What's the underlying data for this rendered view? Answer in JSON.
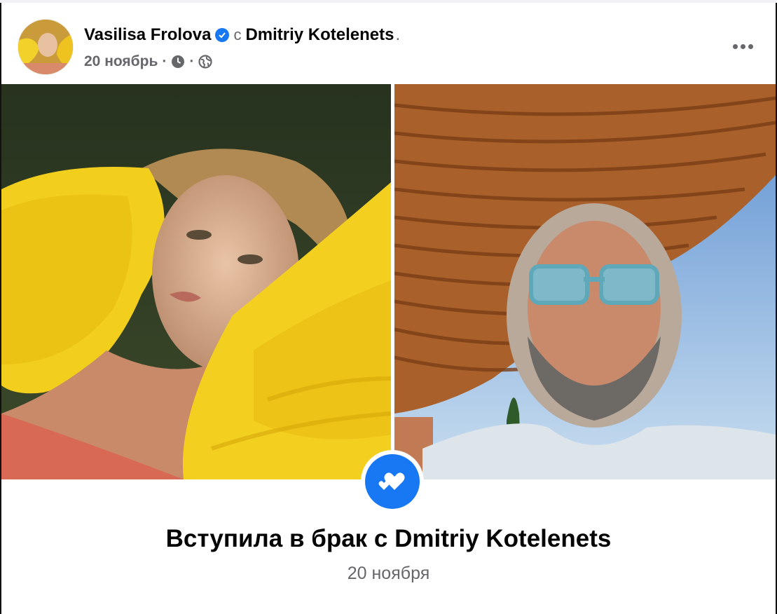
{
  "post": {
    "author": "Vasilisa Frolova",
    "with_word": "с",
    "tagged": "Dmitriy Kotelenets",
    "tagged_suffix": ".",
    "date": "20 ноябрь",
    "separator": "·"
  },
  "event": {
    "title": "Вступила в брак с Dmitriy Kotelenets",
    "date": "20 ноября"
  },
  "colors": {
    "accent": "#1877f2",
    "secondary_text": "#65676b",
    "primary_text": "#050505"
  },
  "icons": {
    "verified": "verified-badge-icon",
    "clock": "clock-icon",
    "audience": "globe-icon",
    "more": "more-options-icon",
    "event": "hearts-icon"
  }
}
